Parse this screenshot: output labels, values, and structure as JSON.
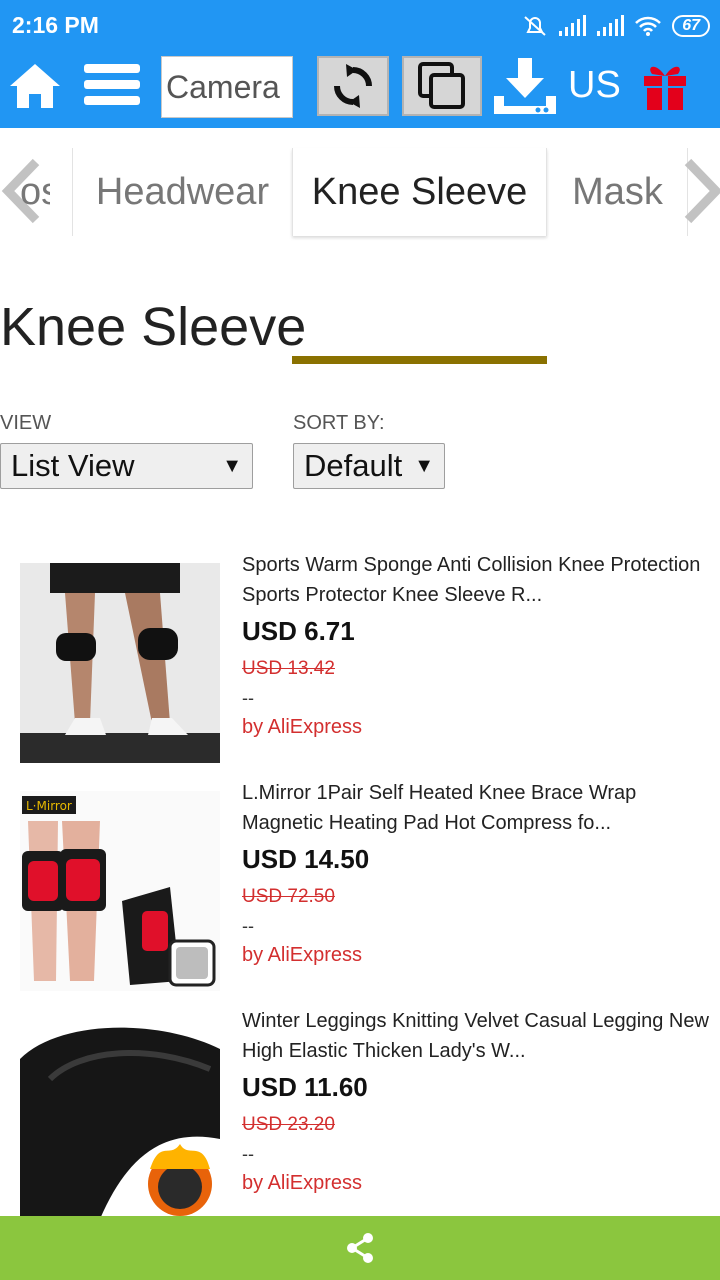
{
  "status_bar": {
    "time": "2:16 PM",
    "battery": "67",
    "icons": [
      "alarm-off-icon",
      "signal-icon",
      "signal-icon",
      "wifi-icon",
      "battery-icon"
    ]
  },
  "toolbar": {
    "camera_value": "Camera",
    "region": "US",
    "icons": [
      "home-icon",
      "menu-icon",
      "refresh-icon",
      "copy-icon",
      "download-icon",
      "gift-icon"
    ],
    "gift_color": "#e3001b",
    "bar_color": "#2196f3"
  },
  "categories": {
    "partial_label": "os",
    "items": [
      "Headwear",
      "Knee Sleeve",
      "Mask"
    ],
    "active": "Knee Sleeve",
    "active_underline_color": "#8a7100"
  },
  "page": {
    "title": "Knee Sleeve"
  },
  "filters": {
    "view_label": "VIEW",
    "view_value": "List View",
    "sort_label": "SORT BY:",
    "sort_value": "Default"
  },
  "products": [
    {
      "title": "Sports Warm Sponge Anti Collision Knee Protection Sports Protector Knee Sleeve R...",
      "price": "USD 6.71",
      "old_price": "USD 13.42",
      "rating": "--",
      "seller": "by AliExpress"
    },
    {
      "title": "L.Mirror 1Pair Self Heated Knee Brace Wrap Magnetic Heating Pad Hot Compress fo...",
      "price": "USD 14.50",
      "old_price": "USD 72.50",
      "rating": "--",
      "seller": "by AliExpress",
      "image_brand": "L·Mirror"
    },
    {
      "title": "Winter Leggings Knitting Velvet Casual Legging New High Elastic Thicken Lady's W...",
      "price": "USD 11.60",
      "old_price": "USD 23.20",
      "rating": "--",
      "seller": "by AliExpress"
    }
  ],
  "bottom_bar": {
    "icon": "share-icon",
    "color": "#8bc63e"
  }
}
